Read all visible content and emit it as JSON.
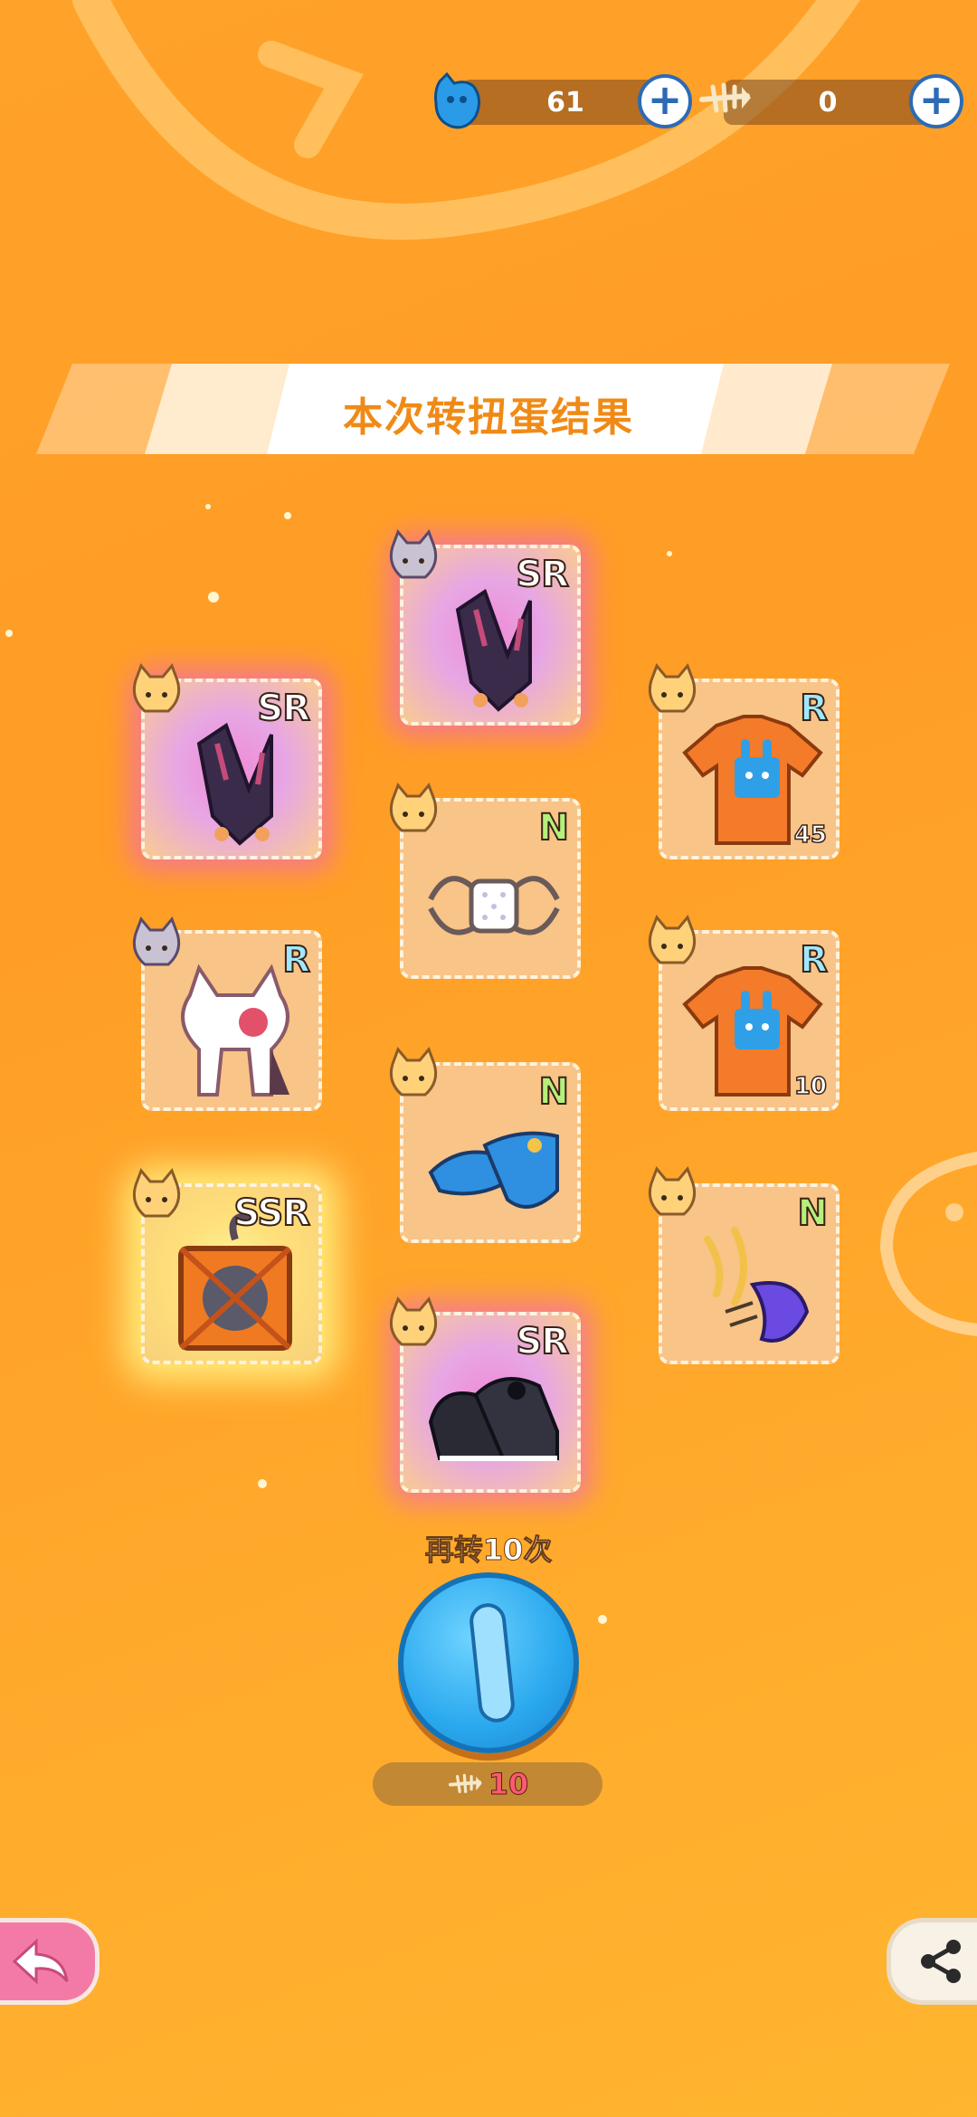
{
  "currency": {
    "gems": {
      "icon": "blue-cat-gem-icon",
      "value": "61"
    },
    "fishbones": {
      "icon": "fishbone-icon",
      "value": "0"
    }
  },
  "banner": {
    "title": "本次转扭蛋结果"
  },
  "items": [
    {
      "id": "left-1",
      "rarity": "SR",
      "name_icon": "black-cat-ears-headband-icon",
      "count": ""
    },
    {
      "id": "left-2",
      "rarity": "R",
      "name_icon": "white-cat-hood-icon",
      "count": ""
    },
    {
      "id": "left-3",
      "rarity": "SSR",
      "name_icon": "cat-crate-box-icon",
      "count": ""
    },
    {
      "id": "mid-1",
      "rarity": "SR",
      "name_icon": "black-cat-ears-headband-icon",
      "count": ""
    },
    {
      "id": "mid-2",
      "rarity": "N",
      "name_icon": "white-face-mask-icon",
      "count": ""
    },
    {
      "id": "mid-3",
      "rarity": "N",
      "name_icon": "blue-sandals-icon",
      "count": ""
    },
    {
      "id": "mid-4",
      "rarity": "SR",
      "name_icon": "black-sneakers-icon",
      "count": ""
    },
    {
      "id": "right-1",
      "rarity": "R",
      "name_icon": "orange-bunny-tshirt-icon",
      "count": "45"
    },
    {
      "id": "right-2",
      "rarity": "R",
      "name_icon": "orange-bunny-tshirt-icon",
      "count": "10"
    },
    {
      "id": "right-3",
      "rarity": "N",
      "name_icon": "fish-hair-clips-icon",
      "count": ""
    }
  ],
  "spin_again": {
    "label": "再转10次",
    "cost": "10",
    "cost_icon": "fishbone-icon"
  },
  "colors": {
    "background": "#ffa22a",
    "sr_glow": "#ec5ae6",
    "ssr_glow": "#fffa8c",
    "spin_button": "#2aa8ee",
    "cost_text": "#ff5a6e"
  }
}
